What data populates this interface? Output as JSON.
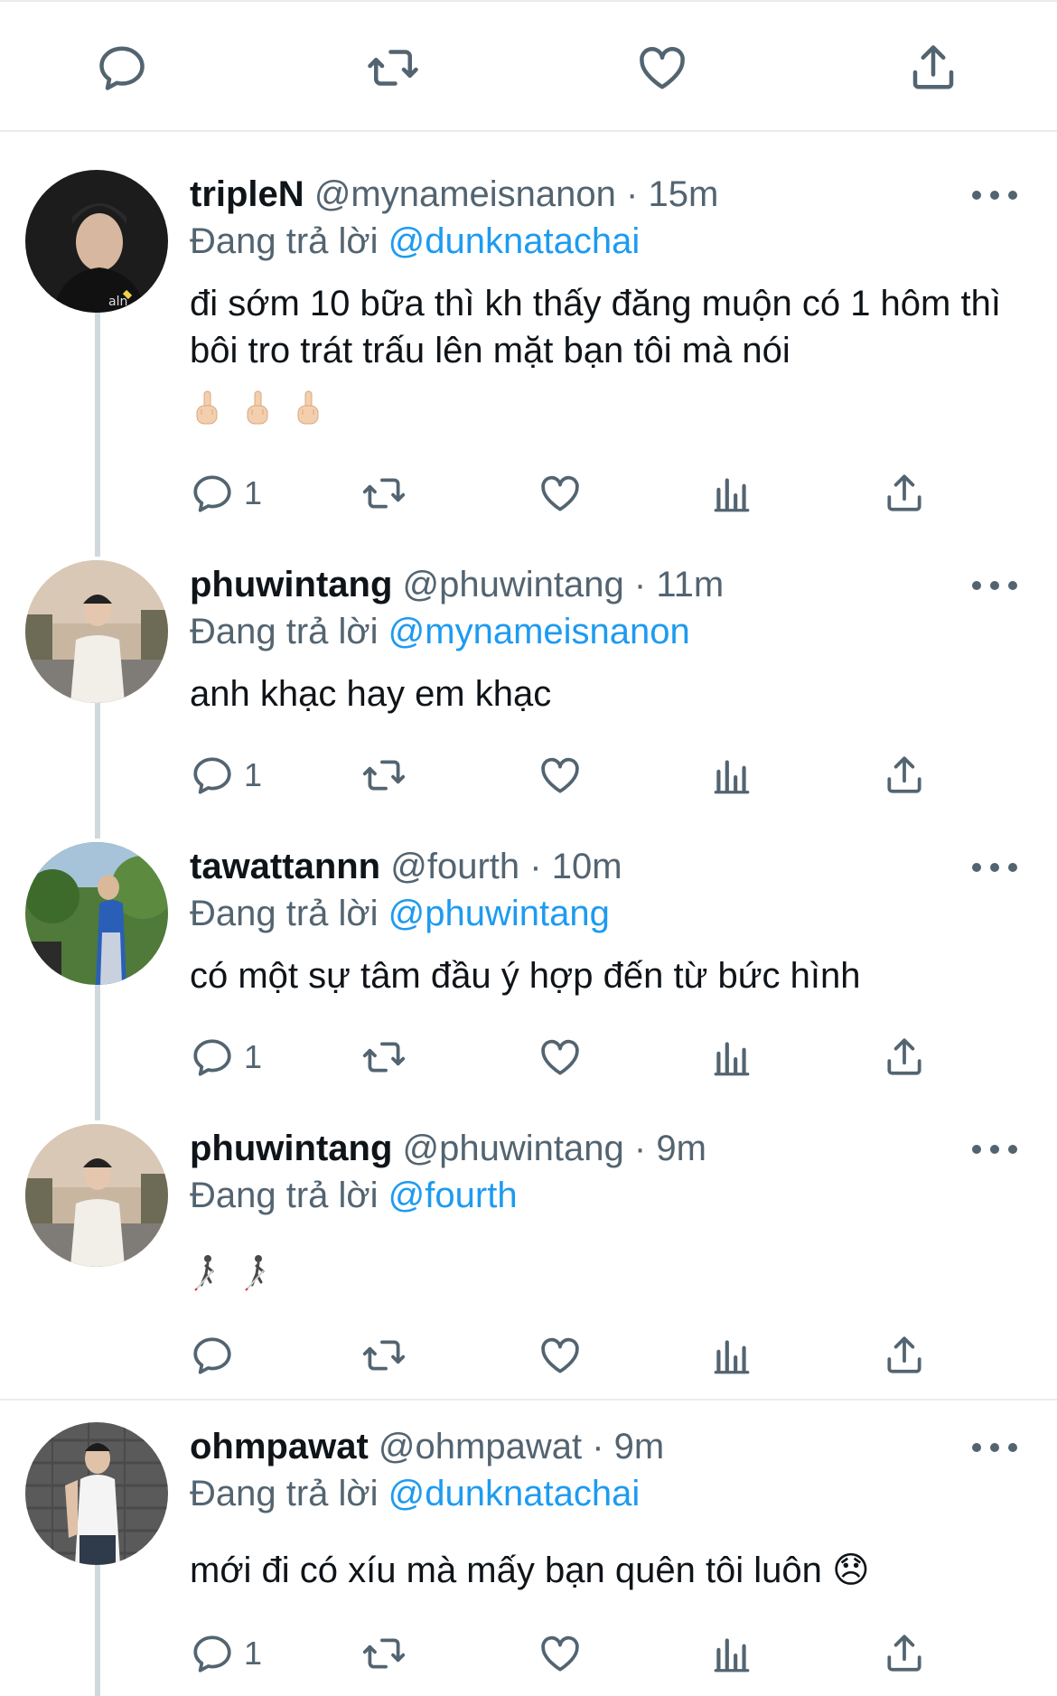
{
  "colors": {
    "link": "#1d9bf0",
    "secondary_text": "#536471",
    "icon": "#536471",
    "divider": "#e7ecf0"
  },
  "icons": {
    "reply": "comment-bubble-icon",
    "retweet": "retweet-arrows-icon",
    "like": "heart-icon",
    "analytics": "bar-chart-icon",
    "share": "share-upload-icon",
    "more": "more-dots-icon"
  },
  "tweets": [
    {
      "name": "tripleN",
      "handle": "@mynameisnanon",
      "sep": "·",
      "time": "15m",
      "reply_prefix": "Đang trả lời",
      "reply_to": "@dunknatachai",
      "text": "đi sớm 10 bữa thì kh thấy đăng muộn có 1 hôm thì bôi tro trát trấu lên mặt bạn tôi mà nói",
      "emoji": [
        "🖕🏻",
        "🖕🏻",
        "🖕🏻"
      ],
      "reply_count": "1"
    },
    {
      "name": "phuwintang",
      "handle": "@phuwintang",
      "sep": "·",
      "time": "11m",
      "reply_prefix": "Đang trả lời",
      "reply_to": "@mynameisnanon",
      "text": "anh khạc hay em khạc",
      "reply_count": "1"
    },
    {
      "name": "tawattannn",
      "handle": "@fourth",
      "sep": "·",
      "time": "10m",
      "reply_prefix": "Đang trả lời",
      "reply_to": "@phuwintang",
      "text": "có một sự tâm đầu ý hợp đến từ bức hình",
      "reply_count": "1"
    },
    {
      "name": "phuwintang",
      "handle": "@phuwintang",
      "sep": "·",
      "time": "9m",
      "reply_prefix": "Đang trả lời",
      "reply_to": "@fourth",
      "emoji": [
        "🧑‍🦯",
        "🧑‍🦯"
      ],
      "reply_count": ""
    },
    {
      "name": "ohmpawat",
      "handle": "@ohmpawat",
      "sep": "·",
      "time": "9m",
      "reply_prefix": "Đang trả lời",
      "reply_to": "@dunknatachai",
      "text": "mới đi có xíu mà mấy bạn quên tôi luôn 😞",
      "reply_count": "1"
    }
  ]
}
